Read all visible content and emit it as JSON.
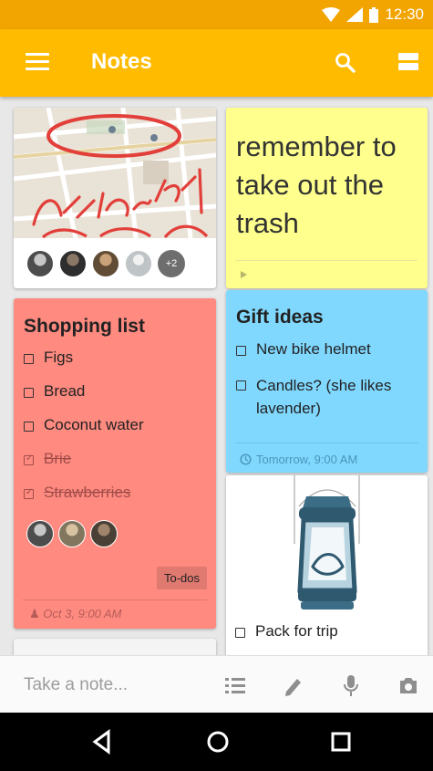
{
  "status_bar": {
    "time": "12:30",
    "icons": [
      "wifi-icon",
      "signal-icon",
      "battery-icon"
    ]
  },
  "app_bar": {
    "title": "Notes",
    "icons": [
      "menu-icon",
      "search-icon",
      "grid-view-icon"
    ],
    "color": "#ffbb00"
  },
  "notes": [
    {
      "id": "map",
      "type": "image",
      "handwriting": "Gotta check the atrium!",
      "collaborators": [
        "person-1",
        "person-2",
        "person-3",
        "person-4"
      ],
      "extra_collaborators": "+2",
      "color": "#ffffff"
    },
    {
      "id": "trash",
      "type": "text",
      "text": "remember to take out the trash",
      "color": "#ffff8d"
    },
    {
      "id": "shopping",
      "type": "checklist",
      "title": "Shopping list",
      "items": [
        {
          "label": "Figs",
          "checked": false
        },
        {
          "label": "Bread",
          "checked": false
        },
        {
          "label": "Coconut water",
          "checked": false
        },
        {
          "label": "Brie",
          "checked": true
        },
        {
          "label": "Strawberries",
          "checked": true
        }
      ],
      "collaborators": [
        "person-1",
        "person-2",
        "person-3"
      ],
      "label_chip": "To-dos",
      "reminder": "Oct 3, 9:00 AM",
      "color": "#ff8a80"
    },
    {
      "id": "gifts",
      "type": "checklist",
      "title": "Gift ideas",
      "items": [
        {
          "label": "New bike helmet",
          "checked": false
        },
        {
          "label": "Candles? (she likes lavender)",
          "checked": false
        }
      ],
      "reminder": "Tomorrow, 9:00 AM",
      "color": "#80d8ff"
    },
    {
      "id": "lantern",
      "type": "image-checklist",
      "items": [
        {
          "label": "Pack for trip",
          "checked": false
        }
      ],
      "color": "#ffffff"
    }
  ],
  "bottom_bar": {
    "placeholder": "Take a note...",
    "icons": [
      "list-icon",
      "pen-icon",
      "microphone-icon",
      "camera-icon"
    ]
  },
  "nav_bar": {
    "icons": [
      "back-icon",
      "home-icon",
      "recents-icon"
    ]
  }
}
